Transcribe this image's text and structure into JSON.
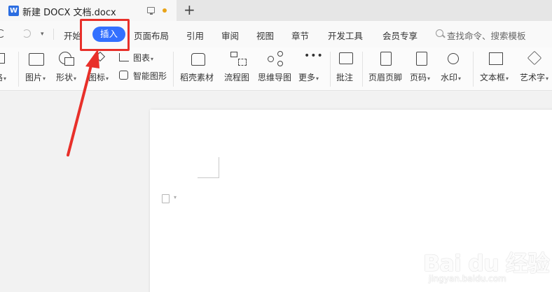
{
  "tab": {
    "title": "新建 DOCX 文档.docx",
    "doc_icon_letter": "W",
    "new_tab_glyph": "+"
  },
  "menu": {
    "items": [
      "开始",
      "插入",
      "页面布局",
      "引用",
      "审阅",
      "视图",
      "章节",
      "开发工具",
      "会员专享"
    ],
    "active": "插入",
    "search_placeholder": "查找命令、搜索模板"
  },
  "ribbon": {
    "partial_label": "格",
    "picture": "图片",
    "shape": "形状",
    "icon": "图标",
    "chart": "图表",
    "smart_art": "智能图形",
    "material": "稻壳素材",
    "flowchart": "流程图",
    "mindmap": "思维导图",
    "more": "更多",
    "comment": "批注",
    "header_footer": "页眉页脚",
    "page_number": "页码",
    "watermark": "水印",
    "text_box": "文本框",
    "word_art": "艺术字"
  },
  "watermark": {
    "logo": "Bai du 经验",
    "url": "jingyan.baidu.com"
  },
  "colors": {
    "accent": "#3370ff",
    "annotation": "#e8302a",
    "unsaved": "#e8a318"
  }
}
